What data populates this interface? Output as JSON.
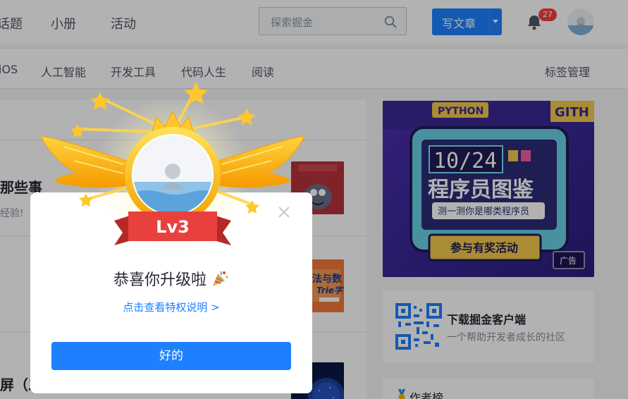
{
  "header": {
    "nav": [
      "话题",
      "小册",
      "活动"
    ],
    "search_placeholder": "探索掘金",
    "write_label": "写文章",
    "notification_count": "27"
  },
  "tags": {
    "items": [
      "iOS",
      "人工智能",
      "开发工具",
      "代码人生",
      "阅读"
    ],
    "manage_label": "标签管理"
  },
  "feed": {
    "items": [
      {
        "title": "那些事",
        "excerpt": "经验!"
      },
      {
        "title": "屏（二"
      }
    ],
    "thumb2_text": "算法与数\nTrie字"
  },
  "sidebar": {
    "banner": {
      "tags": [
        "PYTHON",
        "GITH"
      ],
      "date": "10/24",
      "headline": "程序员图鉴",
      "subline": "测一测你是哪类程序员",
      "cta": "参与有奖活动",
      "ad_label": "广告"
    },
    "download": {
      "title": "下载掘金客户端",
      "subtitle": "一个帮助开发者成长的社区"
    },
    "author_rank_label": "作者榜"
  },
  "dialog": {
    "level": "Lv3",
    "message": "恭喜你升级啦",
    "link": "点击查看特权说明 >",
    "ok_label": "好的"
  },
  "colors": {
    "primary": "#1e80ff",
    "badge": "#f53f3f",
    "ribbon": "#e8413d",
    "gold": "#f7b500"
  }
}
